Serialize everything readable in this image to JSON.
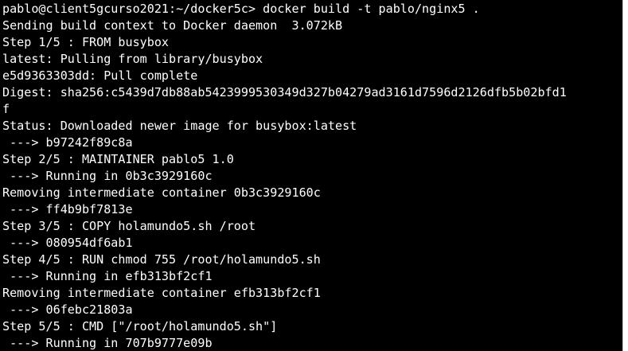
{
  "terminal": {
    "lines": [
      "pablo@client5gcurso2021:~/docker5c> docker build -t pablo/nginx5 .",
      "Sending build context to Docker daemon  3.072kB",
      "Step 1/5 : FROM busybox",
      "latest: Pulling from library/busybox",
      "e5d9363303dd: Pull complete",
      "Digest: sha256:c5439d7db88ab5423999530349d327b04279ad3161d7596d2126dfb5b02bfd1",
      "f",
      "Status: Downloaded newer image for busybox:latest",
      " ---> b97242f89c8a",
      "Step 2/5 : MAINTAINER pablo5 1.0",
      " ---> Running in 0b3c3929160c",
      "Removing intermediate container 0b3c3929160c",
      " ---> ff4b9bf7813e",
      "Step 3/5 : COPY holamundo5.sh /root",
      " ---> 080954df6ab1",
      "Step 4/5 : RUN chmod 755 /root/holamundo5.sh",
      " ---> Running in efb313bf2cf1",
      "Removing intermediate container efb313bf2cf1",
      " ---> 06febc21803a",
      "Step 5/5 : CMD [\"/root/holamundo5.sh\"]",
      " ---> Running in 707b9777e09b"
    ],
    "colors": {
      "background": "#000000",
      "foreground": "#ffffff"
    }
  }
}
